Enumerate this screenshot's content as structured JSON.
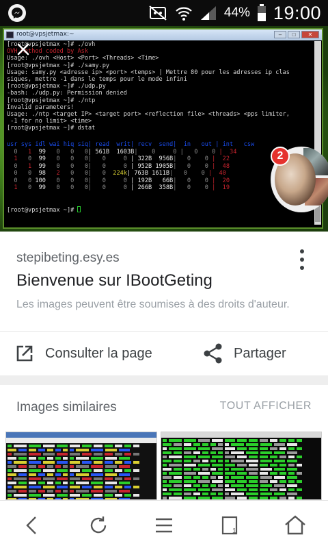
{
  "status_bar": {
    "battery_percent": "44%",
    "time": "19:00",
    "icons": [
      "messenger-icon",
      "mute-icon",
      "wifi-icon",
      "signal-icon",
      "battery-icon"
    ]
  },
  "terminal": {
    "window_title": "root@vpsjetmax:~",
    "lines": [
      {
        "text": "[root@vpsjetmax ~]# ./ovh",
        "color": "default"
      },
      {
        "text": "OVH Method coded by Ask",
        "color": "red"
      },
      {
        "text": "Usage: ./ovh <Host> <Port> <Threads> <Time>",
        "color": "default"
      },
      {
        "text": "[root@vpsjetmax ~]# ./samy.py",
        "color": "default"
      },
      {
        "text": "Usage: samy.py <adresse ip> <port> <temps> | Mettre 80 pour les adresses ip clas",
        "color": "default"
      },
      {
        "text": "siques, mettre -1 dans le temps pour le mode infini",
        "color": "default"
      },
      {
        "text": "[root@vpsjetmax ~]# ./udp.py",
        "color": "default"
      },
      {
        "text": "-bash: ./udp.py: Permission denied",
        "color": "default"
      },
      {
        "text": "[root@vpsjetmax ~]# ./ntp",
        "color": "default"
      },
      {
        "text": "Invalid parameters!",
        "color": "default"
      },
      {
        "text": "Usage: ./ntp <target IP> <target port> <reflection file> <threads> <pps limiter,",
        "color": "default"
      },
      {
        "text": " -1 for no limit> <time>",
        "color": "default"
      },
      {
        "text": "[root@vpsjetmax ~]# dstat",
        "color": "default"
      }
    ],
    "dstat_header": "usr sys idl wai hiq siq| read  writ| recv  send|  in   out | int   csw",
    "dstat_rows": [
      [
        {
          "t": "  0 ",
          "c": "c-grey"
        },
        {
          "t": "  1 ",
          "c": "c-red"
        },
        {
          "t": " 99 ",
          "c": "c-white"
        },
        {
          "t": "  0 ",
          "c": "c-grey"
        },
        {
          "t": "  0 ",
          "c": "c-grey"
        },
        {
          "t": "  0",
          "c": "c-grey"
        },
        {
          "t": "| 561B ",
          "c": "c-white"
        },
        {
          "t": " 1603B",
          "c": "c-white"
        },
        {
          "t": "|    0 ",
          "c": "c-grey"
        },
        {
          "t": "    0 ",
          "c": "c-grey"
        },
        {
          "t": "|   0 ",
          "c": "c-grey"
        },
        {
          "t": "   0 ",
          "c": "c-grey"
        },
        {
          "t": "|  34 ",
          "c": "c-red"
        }
      ],
      [
        {
          "t": "  1 ",
          "c": "c-red"
        },
        {
          "t": "  0 ",
          "c": "c-grey"
        },
        {
          "t": " 99 ",
          "c": "c-white"
        },
        {
          "t": "  0 ",
          "c": "c-grey"
        },
        {
          "t": "  0 ",
          "c": "c-grey"
        },
        {
          "t": "  0",
          "c": "c-grey"
        },
        {
          "t": "|   0 ",
          "c": "c-grey"
        },
        {
          "t": "    0 ",
          "c": "c-grey"
        },
        {
          "t": "| 322B ",
          "c": "c-white"
        },
        {
          "t": " 956B",
          "c": "c-white"
        },
        {
          "t": "|   0 ",
          "c": "c-grey"
        },
        {
          "t": "   0 ",
          "c": "c-grey"
        },
        {
          "t": "|  22 ",
          "c": "c-red"
        }
      ],
      [
        {
          "t": "  0 ",
          "c": "c-grey"
        },
        {
          "t": "  1 ",
          "c": "c-red"
        },
        {
          "t": " 99 ",
          "c": "c-white"
        },
        {
          "t": "  0 ",
          "c": "c-grey"
        },
        {
          "t": "  0 ",
          "c": "c-grey"
        },
        {
          "t": "  0",
          "c": "c-grey"
        },
        {
          "t": "|   0 ",
          "c": "c-grey"
        },
        {
          "t": "    0 ",
          "c": "c-grey"
        },
        {
          "t": "| 952B ",
          "c": "c-white"
        },
        {
          "t": "1905B",
          "c": "c-white"
        },
        {
          "t": "|   0 ",
          "c": "c-grey"
        },
        {
          "t": "   0 ",
          "c": "c-grey"
        },
        {
          "t": "|  48 ",
          "c": "c-red"
        }
      ],
      [
        {
          "t": "  0 ",
          "c": "c-grey"
        },
        {
          "t": "  0 ",
          "c": "c-grey"
        },
        {
          "t": " 98 ",
          "c": "c-white"
        },
        {
          "t": "  2 ",
          "c": "c-red"
        },
        {
          "t": "  0 ",
          "c": "c-grey"
        },
        {
          "t": "  0",
          "c": "c-grey"
        },
        {
          "t": "|   0 ",
          "c": "c-grey"
        },
        {
          "t": " 224k",
          "c": "c-yellow"
        },
        {
          "t": "| 763B ",
          "c": "c-white"
        },
        {
          "t": "1611B",
          "c": "c-white"
        },
        {
          "t": "|   0 ",
          "c": "c-grey"
        },
        {
          "t": "   0 ",
          "c": "c-grey"
        },
        {
          "t": "|  40 ",
          "c": "c-red"
        }
      ],
      [
        {
          "t": "  0 ",
          "c": "c-grey"
        },
        {
          "t": "  0 ",
          "c": "c-grey"
        },
        {
          "t": "100 ",
          "c": "c-white"
        },
        {
          "t": "  0 ",
          "c": "c-grey"
        },
        {
          "t": "  0 ",
          "c": "c-grey"
        },
        {
          "t": "  0",
          "c": "c-grey"
        },
        {
          "t": "|   0 ",
          "c": "c-grey"
        },
        {
          "t": "    0 ",
          "c": "c-grey"
        },
        {
          "t": "| 192B ",
          "c": "c-white"
        },
        {
          "t": "  66B",
          "c": "c-white"
        },
        {
          "t": "|   0 ",
          "c": "c-grey"
        },
        {
          "t": "   0 ",
          "c": "c-grey"
        },
        {
          "t": "|  20 ",
          "c": "c-red"
        }
      ],
      [
        {
          "t": "  1 ",
          "c": "c-red"
        },
        {
          "t": "  0 ",
          "c": "c-grey"
        },
        {
          "t": " 99 ",
          "c": "c-white"
        },
        {
          "t": "  0 ",
          "c": "c-grey"
        },
        {
          "t": "  0 ",
          "c": "c-grey"
        },
        {
          "t": "  0",
          "c": "c-grey"
        },
        {
          "t": "|   0 ",
          "c": "c-grey"
        },
        {
          "t": "    0 ",
          "c": "c-grey"
        },
        {
          "t": "| 266B ",
          "c": "c-white"
        },
        {
          "t": " 358B",
          "c": "c-white"
        },
        {
          "t": "|   0 ",
          "c": "c-grey"
        },
        {
          "t": "   0 ",
          "c": "c-grey"
        },
        {
          "t": "|  19 ",
          "c": "c-red"
        }
      ]
    ],
    "last_prompt": "[root@vpsjetmax ~]# "
  },
  "chat_head": {
    "badge_count": "2"
  },
  "result": {
    "domain": "stepibeting.esy.es",
    "title": "Bienvenue sur IBootGeting",
    "copyright_notice": "Les images peuvent être soumises à des droits d'auteur."
  },
  "actions": {
    "visit_label": "Consulter la page",
    "share_label": "Partager"
  },
  "similar": {
    "title": "Images similaires",
    "see_all_label": "TOUT AFFICHER"
  },
  "colors": {
    "terminal_bg": "#000000",
    "terminal_red": "#c8242e",
    "terminal_blue": "#2856f5",
    "terminal_green": "#27c72d",
    "badge_red": "#e5322d"
  }
}
